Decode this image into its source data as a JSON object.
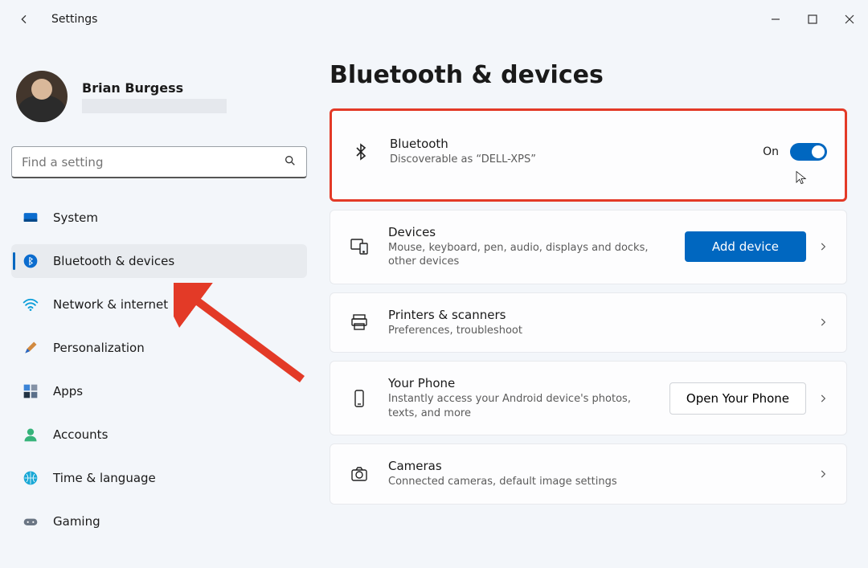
{
  "window": {
    "title": "Settings"
  },
  "profile": {
    "name": "Brian Burgess"
  },
  "search": {
    "placeholder": "Find a setting"
  },
  "nav": {
    "items": [
      {
        "label": "System"
      },
      {
        "label": "Bluetooth & devices"
      },
      {
        "label": "Network & internet"
      },
      {
        "label": "Personalization"
      },
      {
        "label": "Apps"
      },
      {
        "label": "Accounts"
      },
      {
        "label": "Time & language"
      },
      {
        "label": "Gaming"
      }
    ],
    "active_index": 1
  },
  "page": {
    "title": "Bluetooth & devices"
  },
  "bluetooth_card": {
    "title": "Bluetooth",
    "subtitle": "Discoverable as “DELL-XPS”",
    "state_label": "On",
    "state": true
  },
  "devices_card": {
    "title": "Devices",
    "subtitle": "Mouse, keyboard, pen, audio, displays and docks, other devices",
    "button": "Add device"
  },
  "printers_card": {
    "title": "Printers & scanners",
    "subtitle": "Preferences, troubleshoot"
  },
  "phone_card": {
    "title": "Your Phone",
    "subtitle": "Instantly access your Android device's photos, texts, and more",
    "button": "Open Your Phone"
  },
  "cameras_card": {
    "title": "Cameras",
    "subtitle": "Connected cameras, default image settings"
  }
}
